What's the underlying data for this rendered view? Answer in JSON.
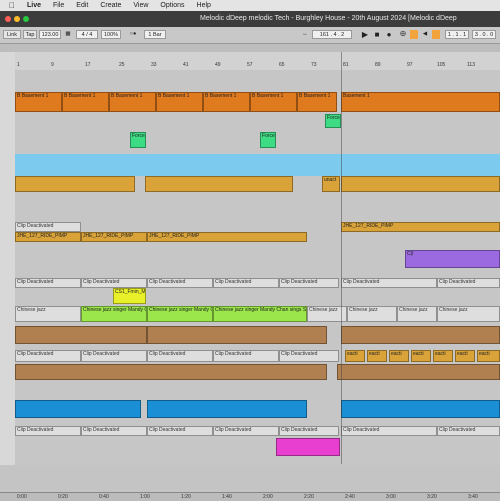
{
  "menubar": {
    "apple": "",
    "app": "Live",
    "items": [
      "File",
      "Edit",
      "Create",
      "View",
      "Options",
      "Help"
    ]
  },
  "window": {
    "title": "Melodic dDeep melodic Tech - Burghley House - 20th August 2024  [Melodic dDeep"
  },
  "transport": {
    "link": "Link",
    "tap": "Tap",
    "tempo": "123.00",
    "sig_num": "4",
    "sig_sep": "/",
    "sig_den": "4",
    "zoom": "100%",
    "quantize": "1 Bar",
    "position": "161 .  4 .  2",
    "loop_start": "1 .  1 .  1",
    "loop_len": "3 .  0 .  0"
  },
  "ruler": {
    "bars": [
      "1",
      "9",
      "17",
      "25",
      "33",
      "41",
      "49",
      "57",
      "65",
      "73",
      "81",
      "89",
      "97",
      "105",
      "113"
    ]
  },
  "time_ruler": {
    "labels": [
      "0:00",
      "0:20",
      "0:40",
      "1:00",
      "1:20",
      "1:40",
      "2:00",
      "2:20",
      "2:40",
      "3:00",
      "3:20",
      "3:40"
    ]
  },
  "clips": {
    "basement": "Basement 1",
    "basement_b": "B Basement 1",
    "force": "Force",
    "unact": "unact",
    "deactivated": "Clip Deactivated",
    "jhe": "JHE_127_RIDE_PIMP",
    "chinese": "Chinese jazz singer Mandy Chan sings S",
    "chinese_short": "Chinese jazz",
    "cs": "CS1_Fmin_M",
    "eacti": "eacti",
    "purple": "C(l"
  },
  "colors": {
    "orange": "#e07a1e",
    "green": "#3ddc84",
    "blue": "#7ccbef",
    "gold": "#d9a339",
    "purple": "#9b6ae0",
    "lime": "#9be64a",
    "brown": "#b08050",
    "cyan": "#1a8fd6",
    "pink": "#e83fd1"
  }
}
